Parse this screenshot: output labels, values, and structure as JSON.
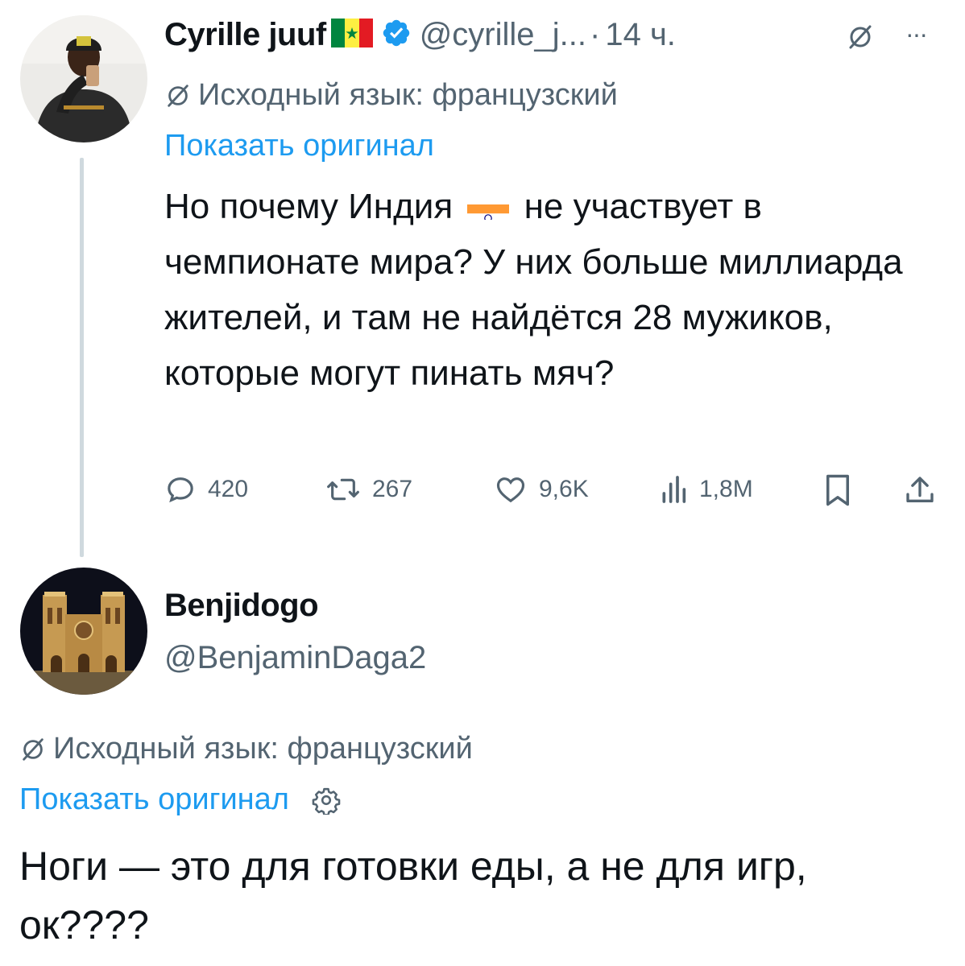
{
  "tweet1": {
    "display_name": "Cyrille juuf",
    "handle": "@cyrille_j...",
    "separator": "·",
    "time": "14 ч.",
    "more": "···",
    "source_language": "Исходный язык: французский",
    "show_original": "Показать оригинал",
    "text_before_flag": "Но почему Индия ",
    "text_after_flag": " не участвует в чемпионате мира? У них больше миллиарда жителей, и там не найдётся 28 мужиков, которые могут пинать мяч?",
    "stats": {
      "replies": "420",
      "reposts": "267",
      "likes": "9,6K",
      "views": "1,8M"
    }
  },
  "tweet2": {
    "display_name": "Benjidogo",
    "handle": "@BenjaminDaga2",
    "source_language": "Исходный язык: французский",
    "show_original": "Показать оригинал",
    "text": "Ноги — это для готовки еды, а не для игр, ок????"
  },
  "colors": {
    "accent": "#1d9bf0",
    "muted": "#536471",
    "text": "#0f1419",
    "verified": "#1d9bf0"
  }
}
